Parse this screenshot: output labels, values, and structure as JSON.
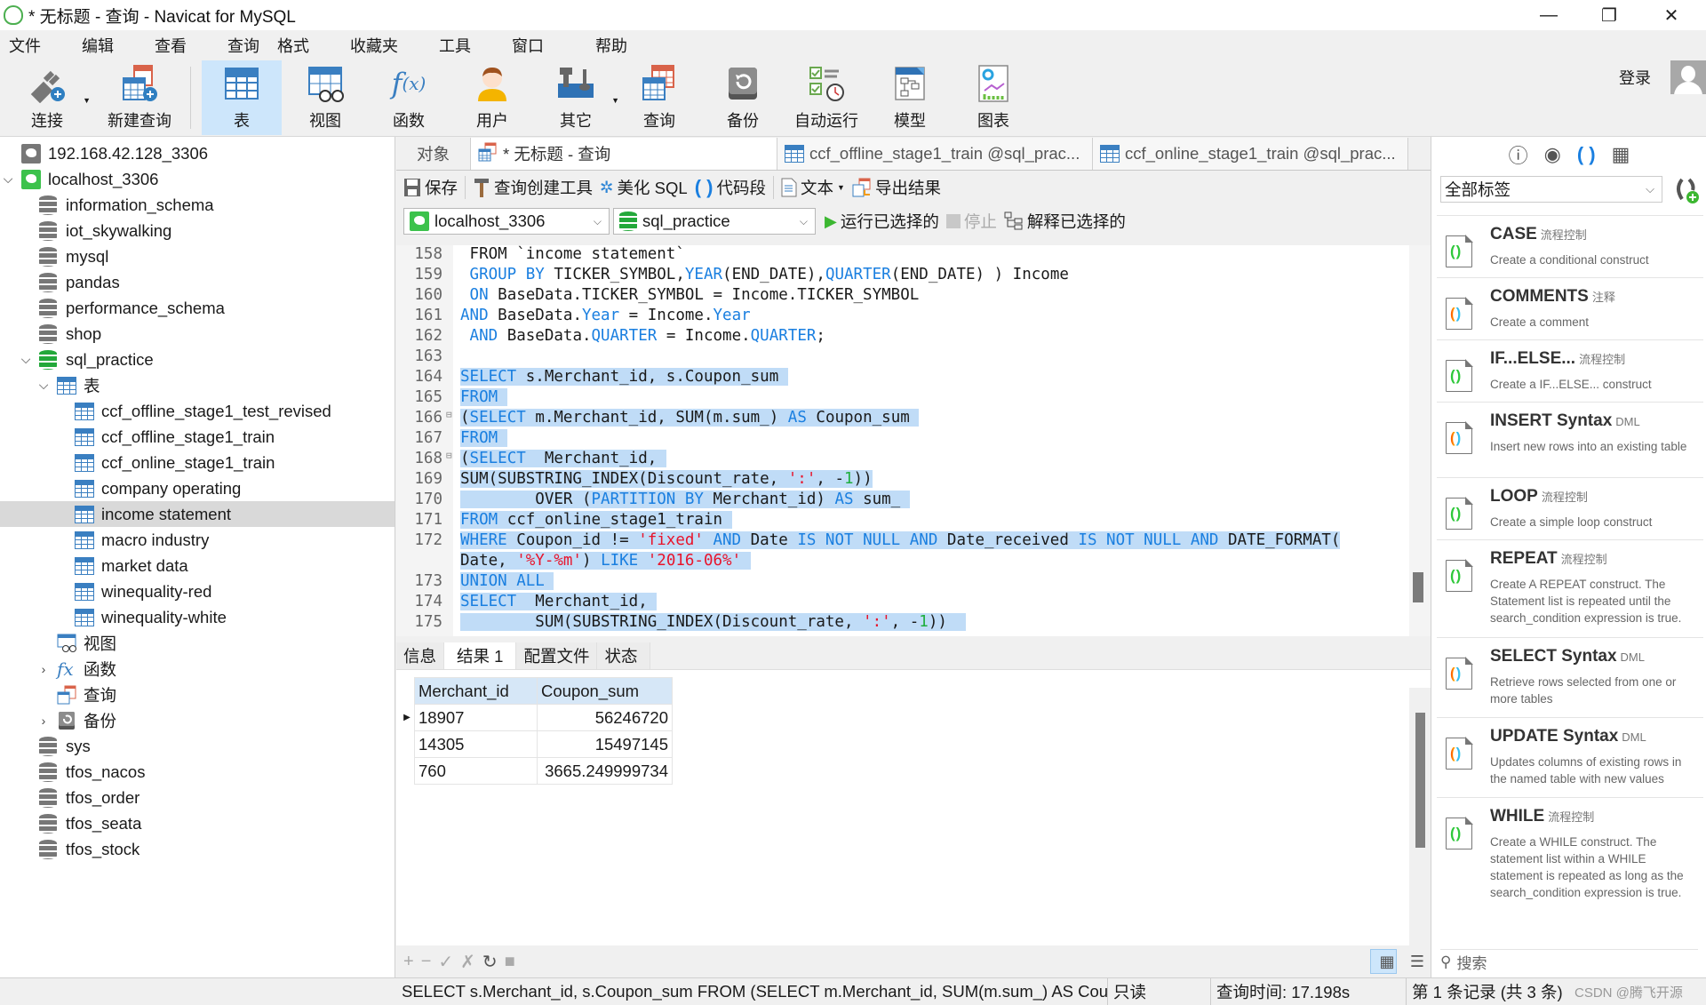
{
  "window": {
    "title": "* 无标题 - 查询 - Navicat for MySQL",
    "controls": [
      "minimize",
      "restore",
      "close"
    ]
  },
  "menu": [
    "文件",
    "编辑",
    "查看",
    "查询",
    "格式",
    "收藏夹",
    "工具",
    "窗口",
    "帮助"
  ],
  "account": {
    "login_label": "登录"
  },
  "toolbar": [
    {
      "label": "连接",
      "icon": "plug-icon",
      "dropdown": true
    },
    {
      "label": "新建查询",
      "icon": "new-query-icon"
    },
    {
      "label": "表",
      "icon": "table-icon",
      "active": true
    },
    {
      "label": "视图",
      "icon": "view-icon"
    },
    {
      "label": "函数",
      "icon": "function-icon"
    },
    {
      "label": "用户",
      "icon": "user-icon"
    },
    {
      "label": "其它",
      "icon": "tools-icon",
      "dropdown": true
    },
    {
      "label": "查询",
      "icon": "query-icon"
    },
    {
      "label": "备份",
      "icon": "backup-icon"
    },
    {
      "label": "自动运行",
      "icon": "schedule-icon"
    },
    {
      "label": "模型",
      "icon": "model-icon"
    },
    {
      "label": "图表",
      "icon": "chart-icon"
    }
  ],
  "sidebar": {
    "items": [
      {
        "label": "192.168.42.128_3306",
        "type": "connection",
        "level": 0,
        "expanded": null
      },
      {
        "label": "localhost_3306",
        "type": "connection-open",
        "level": 0,
        "expanded": true
      },
      {
        "label": "information_schema",
        "type": "database",
        "level": 1
      },
      {
        "label": "iot_skywalking",
        "type": "database",
        "level": 1
      },
      {
        "label": "mysql",
        "type": "database",
        "level": 1
      },
      {
        "label": "pandas",
        "type": "database",
        "level": 1
      },
      {
        "label": "performance_schema",
        "type": "database",
        "level": 1
      },
      {
        "label": "shop",
        "type": "database",
        "level": 1
      },
      {
        "label": "sql_practice",
        "type": "database-open",
        "level": 1,
        "expanded": true
      },
      {
        "label": "表",
        "type": "tables-folder",
        "level": 2,
        "expanded": true
      },
      {
        "label": "ccf_offline_stage1_test_revised",
        "type": "table",
        "level": 3
      },
      {
        "label": "ccf_offline_stage1_train",
        "type": "table",
        "level": 3
      },
      {
        "label": "ccf_online_stage1_train",
        "type": "table",
        "level": 3
      },
      {
        "label": "company operating",
        "type": "table",
        "level": 3
      },
      {
        "label": "income statement",
        "type": "table",
        "level": 3,
        "selected": true
      },
      {
        "label": "macro industry",
        "type": "table",
        "level": 3
      },
      {
        "label": "market data",
        "type": "table",
        "level": 3
      },
      {
        "label": "winequality-red",
        "type": "table",
        "level": 3
      },
      {
        "label": "winequality-white",
        "type": "table",
        "level": 3
      },
      {
        "label": "视图",
        "type": "views-folder",
        "level": 2
      },
      {
        "label": "函数",
        "type": "functions-folder",
        "level": 2,
        "expanded": false
      },
      {
        "label": "查询",
        "type": "queries-folder",
        "level": 2
      },
      {
        "label": "备份",
        "type": "backups-folder",
        "level": 2,
        "expanded": false
      },
      {
        "label": "sys",
        "type": "database",
        "level": 1
      },
      {
        "label": "tfos_nacos",
        "type": "database",
        "level": 1
      },
      {
        "label": "tfos_order",
        "type": "database",
        "level": 1
      },
      {
        "label": "tfos_seata",
        "type": "database",
        "level": 1
      },
      {
        "label": "tfos_stock",
        "type": "database",
        "level": 1
      }
    ]
  },
  "tabs": [
    {
      "label": "对象"
    },
    {
      "label": "* 无标题 - 查询",
      "active": true
    },
    {
      "label": "ccf_offline_stage1_train @sql_prac..."
    },
    {
      "label": "ccf_online_stage1_train @sql_prac..."
    }
  ],
  "query_toolbar": {
    "save": "保存",
    "builder": "查询创建工具",
    "beautify": "美化 SQL",
    "snippet": "代码段",
    "text": "文本",
    "export": "导出结果",
    "connection": "localhost_3306",
    "database": "sql_practice",
    "run_selected": "运行已选择的",
    "stop": "停止",
    "explain_selected": "解释已选择的"
  },
  "editor": {
    "lines": [
      {
        "n": "158",
        "segs": [
          [
            " FROM `income statement`",
            "t"
          ]
        ],
        "hl": false
      },
      {
        "n": "159",
        "segs": [
          [
            " GROUP BY ",
            "k"
          ],
          [
            "TICKER_SYMBOL,",
            "t"
          ],
          [
            "YEAR",
            "k"
          ],
          [
            "(END_DATE),",
            "t"
          ],
          [
            "QUARTER",
            "k"
          ],
          [
            "(END_DATE) ) Income",
            "t"
          ]
        ],
        "hl": false
      },
      {
        "n": "160",
        "segs": [
          [
            " ON ",
            "k"
          ],
          [
            "BaseData.TICKER_SYMBOL = Income.TICKER_SYMBOL",
            "t"
          ]
        ],
        "hl": false
      },
      {
        "n": "161",
        "segs": [
          [
            "AND ",
            "k"
          ],
          [
            "BaseData.",
            "t"
          ],
          [
            "Year",
            "k"
          ],
          [
            " = Income.",
            "t"
          ],
          [
            "Year",
            "k"
          ]
        ],
        "hl": false
      },
      {
        "n": "162",
        "segs": [
          [
            " AND ",
            "k"
          ],
          [
            "BaseData.",
            "t"
          ],
          [
            "QUARTER",
            "k"
          ],
          [
            " = Income.",
            "t"
          ],
          [
            "QUARTER",
            "k"
          ],
          [
            ";",
            "t"
          ]
        ],
        "hl": false
      },
      {
        "n": "163",
        "segs": [],
        "hl": false
      },
      {
        "n": "164",
        "segs": [
          [
            "SELECT ",
            "k"
          ],
          [
            "s.Merchant_id, s.Coupon_sum ",
            "t"
          ]
        ],
        "hl": true
      },
      {
        "n": "165",
        "segs": [
          [
            "FROM ",
            "k"
          ]
        ],
        "hl": true
      },
      {
        "n": "166",
        "fold": true,
        "segs": [
          [
            "(",
            "t"
          ],
          [
            "SELECT ",
            "k"
          ],
          [
            "m.Merchant_id, SUM(m.sum_) ",
            "t"
          ],
          [
            "AS ",
            "k"
          ],
          [
            "Coupon_sum ",
            "t"
          ]
        ],
        "hl": true
      },
      {
        "n": "167",
        "segs": [
          [
            "FROM ",
            "k"
          ]
        ],
        "hl": true
      },
      {
        "n": "168",
        "fold": true,
        "segs": [
          [
            "(",
            "t"
          ],
          [
            "SELECT ",
            "k"
          ],
          [
            " Merchant_id, ",
            "t"
          ]
        ],
        "hl": true
      },
      {
        "n": "169",
        "segs": [
          [
            "SUM(SUBSTRING_INDEX(Discount_rate, ",
            "t"
          ],
          [
            "':'",
            "s"
          ],
          [
            ", -",
            "t"
          ],
          [
            "1",
            "n"
          ],
          [
            "))",
            "t"
          ]
        ],
        "hl": true
      },
      {
        "n": "170",
        "segs": [
          [
            "        OVER (",
            "t"
          ],
          [
            "PARTITION BY ",
            "k"
          ],
          [
            "Merchant_id) ",
            "t"
          ],
          [
            "AS ",
            "k"
          ],
          [
            "sum_ ",
            "t"
          ]
        ],
        "hl": true
      },
      {
        "n": "171",
        "segs": [
          [
            "FROM ",
            "k"
          ],
          [
            "ccf_online_stage1_train ",
            "t"
          ]
        ],
        "hl": true
      },
      {
        "n": "172",
        "segs": [
          [
            "WHERE ",
            "k"
          ],
          [
            "Coupon_id != ",
            "t"
          ],
          [
            "'fixed'",
            "s"
          ],
          [
            " AND ",
            "k"
          ],
          [
            "Date ",
            "t"
          ],
          [
            "IS NOT NULL AND ",
            "k"
          ],
          [
            "Date_received ",
            "t"
          ],
          [
            "IS NOT NULL AND ",
            "k"
          ],
          [
            "DATE_FORMAT(",
            "t"
          ]
        ],
        "hl": true
      },
      {
        "n": "",
        "segs": [
          [
            "Date, ",
            "t"
          ],
          [
            "'%Y-%m'",
            "s"
          ],
          [
            ") ",
            "t"
          ],
          [
            "LIKE ",
            "k"
          ],
          [
            "'2016-06%'",
            "s"
          ],
          [
            " ",
            "t"
          ]
        ],
        "hl": true
      },
      {
        "n": "173",
        "segs": [
          [
            "UNION ALL ",
            "k"
          ]
        ],
        "hl": true
      },
      {
        "n": "174",
        "segs": [
          [
            "SELECT ",
            "k"
          ],
          [
            " Merchant_id, ",
            "t"
          ]
        ],
        "hl": true
      },
      {
        "n": "175",
        "segs": [
          [
            "        SUM(SUBSTRING_INDEX(Discount_rate, ",
            "t"
          ],
          [
            "':'",
            "s"
          ],
          [
            ", -",
            "t"
          ],
          [
            "1",
            "n"
          ],
          [
            "))  ",
            "t"
          ]
        ],
        "hl": true
      }
    ]
  },
  "result_tabs": [
    {
      "label": "信息"
    },
    {
      "label": "结果 1",
      "active": true
    },
    {
      "label": "配置文件"
    },
    {
      "label": "状态"
    }
  ],
  "results": {
    "columns": [
      "Merchant_id",
      "Coupon_sum"
    ],
    "rows": [
      [
        "18907",
        "56246720"
      ],
      [
        "14305",
        "15497145"
      ],
      [
        "760",
        "3665.249999734"
      ]
    ],
    "current_row": 0
  },
  "result_actions": [
    "add-record",
    "delete-record",
    "apply",
    "discard",
    "refresh",
    "stop"
  ],
  "snippets_panel": {
    "tab_icons": [
      "info-icon",
      "eye-icon",
      "snippet-icon",
      "grid-icon"
    ],
    "filter_value": "全部标签",
    "items": [
      {
        "title": "CASE",
        "tag": "流程控制",
        "desc": "Create a conditional construct",
        "color": "green"
      },
      {
        "title": "COMMENTS",
        "tag": "注释",
        "desc": "Create a comment",
        "color": "multi"
      },
      {
        "title": "IF...ELSE...",
        "tag": "流程控制",
        "desc": "Create a IF...ELSE... construct",
        "color": "green"
      },
      {
        "title": "INSERT Syntax",
        "tag": "DML",
        "desc": "Insert new rows into an existing table",
        "color": "multi"
      },
      {
        "title": "LOOP",
        "tag": "流程控制",
        "desc": "Create a simple loop construct",
        "color": "green"
      },
      {
        "title": "REPEAT",
        "tag": "流程控制",
        "desc": "Create A REPEAT construct. The Statement list is repeated until the search_condition expression is true.",
        "color": "green"
      },
      {
        "title": "SELECT Syntax",
        "tag": "DML",
        "desc": "Retrieve rows selected from one or more tables",
        "color": "multi"
      },
      {
        "title": "UPDATE Syntax",
        "tag": "DML",
        "desc": "Updates columns of existing rows in the named table with new values",
        "color": "multi"
      },
      {
        "title": "WHILE",
        "tag": "流程控制",
        "desc": "Create a WHILE construct. The statement list within a WHILE statement is repeated as long as the search_condition expression is true.",
        "color": "green"
      }
    ],
    "search_placeholder": "搜索"
  },
  "statusbar": {
    "sql": "SELECT s.Merchant_id, s.Coupon_sum  FROM (SELECT m.Merchant_id, SUM(m.sum_) AS Cou",
    "mode": "只读",
    "query_time": "查询时间: 17.198s",
    "record_info": "第 1 条记录 (共 3 条)",
    "watermark": "CSDN @腾飞开源"
  }
}
